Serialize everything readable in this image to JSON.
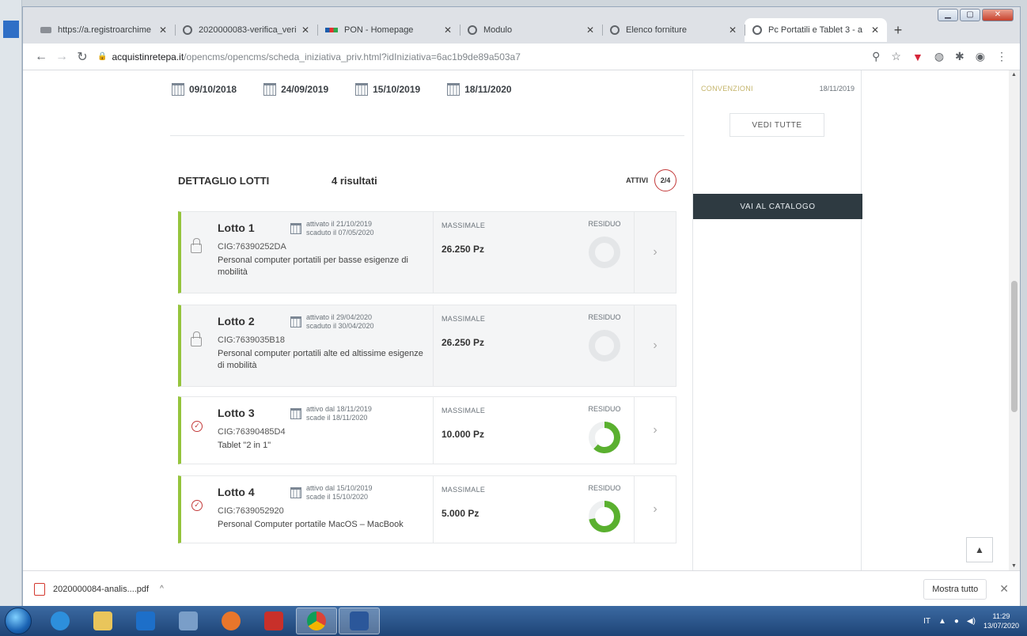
{
  "browser": {
    "tabs": [
      {
        "title": "https://a.registroarchime",
        "icon": "registro-icon"
      },
      {
        "title": "2020000083-verifica_veri",
        "icon": "globe-icon"
      },
      {
        "title": "PON - Homepage",
        "icon": "pon-icon"
      },
      {
        "title": "Modulo",
        "icon": "globe-icon"
      },
      {
        "title": "Elenco forniture",
        "icon": "globe-icon"
      },
      {
        "title": "Pc Portatili e Tablet 3 - a",
        "icon": "globe-icon",
        "active": true
      }
    ],
    "url_host": "acquistinretepa.it",
    "url_path": "/opencms/opencms/scheda_iniziativa_priv.html?idIniziativa=6ac1b9de89a503a7"
  },
  "dates": [
    "09/10/2018",
    "24/09/2019",
    "15/10/2019",
    "18/11/2020"
  ],
  "sidebar": {
    "convenzioni_label": "CONVENZIONI",
    "convenzioni_date": "18/11/2019",
    "vedi_tutte": "VEDI TUTTE",
    "vai_catalogo": "VAI AL CATALOGO"
  },
  "lotti": {
    "title": "DETTAGLIO LOTTI",
    "count": "4 risultati",
    "attivi_label": "ATTIVI",
    "attivi_ratio": "2/4",
    "massimale_label": "MASSIMALE",
    "residuo_label": "RESIDUO",
    "items": [
      {
        "name": "Lotto 1",
        "line1": "attivato il 21/10/2019",
        "line2": "scaduto il 07/05/2020",
        "cig": "CIG:76390252DA",
        "desc": "Personal computer portatili per basse esigenze di mobilità",
        "massimale": "26.250 Pz",
        "status": "expired",
        "residuo_fraction": 0
      },
      {
        "name": "Lotto 2",
        "line1": "attivato il 29/04/2020",
        "line2": "scaduto il 30/04/2020",
        "cig": "CIG:7639035B18",
        "desc": "Personal computer portatili alte ed altissime esigenze di mobilità",
        "massimale": "26.250 Pz",
        "status": "expired",
        "residuo_fraction": 0
      },
      {
        "name": "Lotto 3",
        "line1": "attivo dal 18/11/2019",
        "line2": "scade il 18/11/2020",
        "cig": "CIG:76390485D4",
        "desc": "Tablet \"2 in 1\"",
        "massimale": "10.000 Pz",
        "status": "active",
        "residuo_fraction": 0.62
      },
      {
        "name": "Lotto 4",
        "line1": "attivo dal 15/10/2019",
        "line2": "scade il 15/10/2020",
        "cig": "CIG:7639052920",
        "desc": "Personal Computer portatile MacOS – MacBook",
        "massimale": "5.000 Pz",
        "status": "active",
        "residuo_fraction": 0.72
      }
    ]
  },
  "download": {
    "filename": "2020000084-analis....pdf",
    "show_all": "Mostra tutto"
  },
  "taskbar": {
    "lang": "IT",
    "time": "11:29",
    "date": "13/07/2020"
  },
  "colors": {
    "accent_green": "#95c43c",
    "ring_green": "#5ab02f",
    "catalog_bg": "#2e3a41",
    "status_red": "#c33a3a"
  }
}
